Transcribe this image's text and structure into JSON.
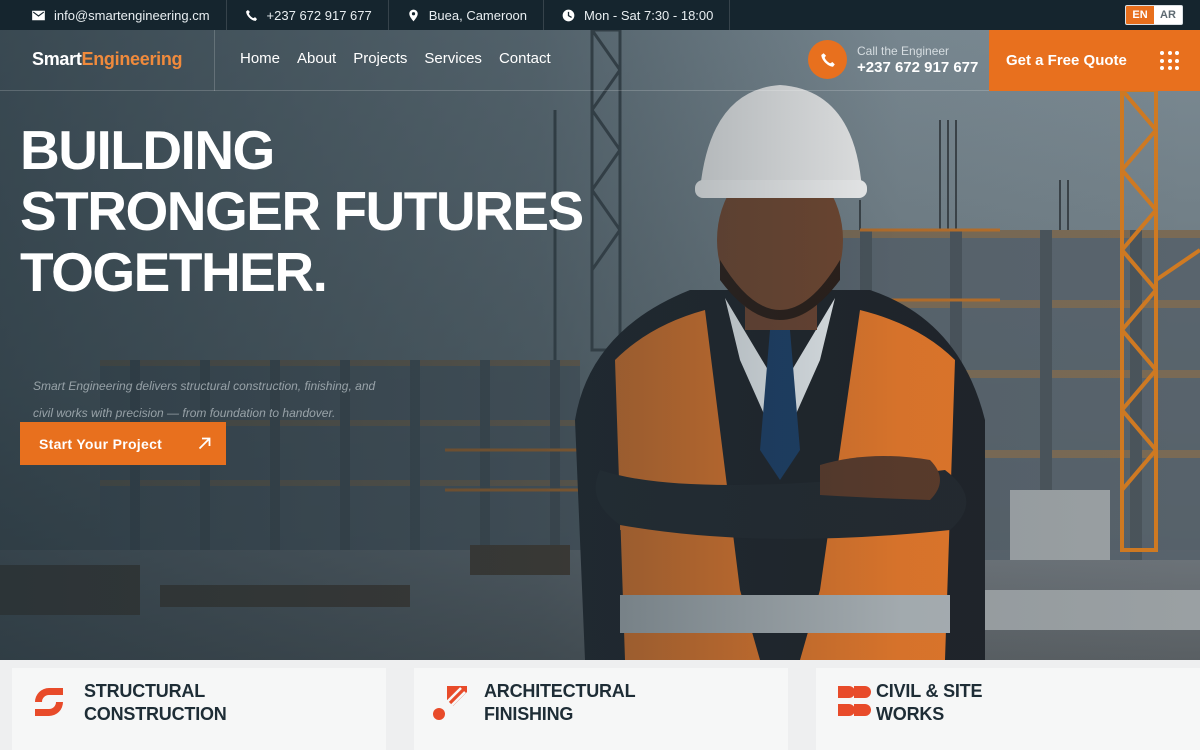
{
  "topbar": {
    "email": "info@smartengineering.cm",
    "phone": "+237 672 917 677",
    "location": "Buea, Cameroon",
    "hours": "Mon - Sat 7:30 - 18:00",
    "lang_en": "EN",
    "lang_ar": "AR",
    "icons": [
      "envelope-icon",
      "phone-icon",
      "map-pin-icon",
      "clock-icon"
    ]
  },
  "nav": {
    "logo_part1": "Smart",
    "logo_part2": "Engineering",
    "items": [
      "Home",
      "About",
      "Projects",
      "Services",
      "Contact"
    ],
    "call_label": "Call the Engineer",
    "call_number": "+237 672 917 677",
    "quote_label": "Get a Free Quote"
  },
  "hero": {
    "headline_line1": "BUILDING",
    "headline_line2": "STRONGER FUTURES",
    "headline_line3": "TOGETHER.",
    "tagline_line1": "Smart Engineering delivers structural construction, finishing, and",
    "tagline_line2": "civil works with precision — from foundation to handover.",
    "cta_label": "Start Your Project"
  },
  "services": [
    {
      "line1": "STRUCTURAL",
      "line2": "CONSTRUCTION",
      "icon": "structural-icon"
    },
    {
      "line1": "ARCHITECTURAL",
      "line2": "FINISHING",
      "icon": "finishing-icon"
    },
    {
      "line1": "CIVIL & SITE",
      "line2": "WORKS",
      "icon": "civil-works-icon"
    }
  ],
  "colors": {
    "accent": "#e8701e",
    "dark": "#15252e",
    "heading": "#1e2d36"
  }
}
